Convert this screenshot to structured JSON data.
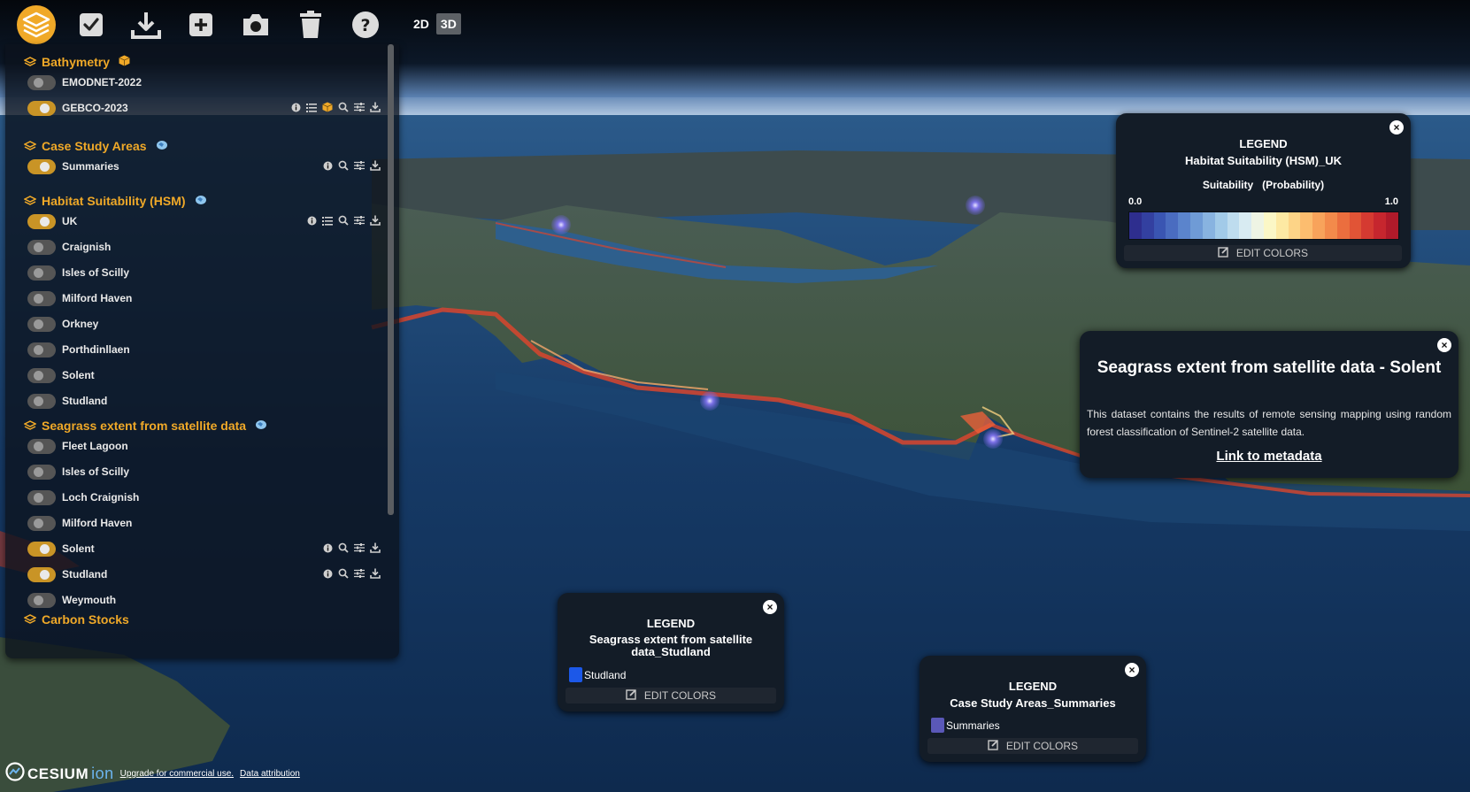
{
  "toolbar": {
    "buttons": [
      {
        "name": "layers",
        "icon": "layers-icon"
      },
      {
        "name": "select",
        "icon": "checkbox-icon"
      },
      {
        "name": "download",
        "icon": "download-icon"
      },
      {
        "name": "add",
        "icon": "plus-icon"
      },
      {
        "name": "screenshot",
        "icon": "camera-icon"
      },
      {
        "name": "delete",
        "icon": "trash-icon"
      },
      {
        "name": "help",
        "icon": "help-icon"
      }
    ],
    "view_modes": [
      "2D",
      "3D"
    ],
    "active_mode": "3D"
  },
  "layer_panel": {
    "groups": [
      {
        "title": "Bathymetry",
        "layers": [
          {
            "name": "EMODNET-2022",
            "on": false,
            "actions": []
          },
          {
            "name": "GEBCO-2023",
            "on": true,
            "actions": [
              "info-icon",
              "list-icon",
              "cube-icon",
              "zoom-icon",
              "sliders-icon",
              "download-icon"
            ]
          }
        ]
      },
      {
        "title": "Case Study Areas",
        "layers": [
          {
            "name": "Summaries",
            "on": true,
            "actions": [
              "info-icon",
              "zoom-icon",
              "sliders-icon",
              "download-icon"
            ]
          }
        ]
      },
      {
        "title": "Habitat Suitability (HSM)",
        "layers": [
          {
            "name": "UK",
            "on": true,
            "actions": [
              "info-icon",
              "list-icon",
              "zoom-icon",
              "sliders-icon",
              "download-icon"
            ]
          },
          {
            "name": "Craignish",
            "on": false,
            "actions": []
          },
          {
            "name": "Isles of Scilly",
            "on": false,
            "actions": []
          },
          {
            "name": "Milford Haven",
            "on": false,
            "actions": []
          },
          {
            "name": "Orkney",
            "on": false,
            "actions": []
          },
          {
            "name": "Porthdinllaen",
            "on": false,
            "actions": []
          },
          {
            "name": "Solent",
            "on": false,
            "actions": []
          },
          {
            "name": "Studland",
            "on": false,
            "actions": []
          }
        ]
      },
      {
        "title": "Seagrass extent from satellite data",
        "layers": [
          {
            "name": "Fleet Lagoon",
            "on": false,
            "actions": []
          },
          {
            "name": "Isles of Scilly",
            "on": false,
            "actions": []
          },
          {
            "name": "Loch Craignish",
            "on": false,
            "actions": []
          },
          {
            "name": "Milford Haven",
            "on": false,
            "actions": []
          },
          {
            "name": "Solent",
            "on": true,
            "actions": [
              "info-icon",
              "zoom-icon",
              "sliders-icon",
              "download-icon"
            ]
          },
          {
            "name": "Studland",
            "on": true,
            "actions": [
              "info-icon",
              "zoom-icon",
              "sliders-icon",
              "download-icon"
            ]
          },
          {
            "name": "Weymouth",
            "on": false,
            "actions": []
          }
        ]
      },
      {
        "title": "Carbon Stocks",
        "layers": []
      }
    ]
  },
  "legend_hsm": {
    "heading": "LEGEND",
    "title": "Habitat Suitability (HSM)_UK",
    "subtitle": "Suitability   (Probability)",
    "min_label": "0.0",
    "max_label": "1.0",
    "edit_label": "EDIT COLORS",
    "ramp": [
      "#2e2e8e",
      "#3340a0",
      "#3a55b2",
      "#4a6cc0",
      "#5b84cc",
      "#6f9bd6",
      "#88b3e0",
      "#a2cae8",
      "#bedcee",
      "#d8ebf2",
      "#eef4e4",
      "#fbf7c6",
      "#fde9a3",
      "#fdd487",
      "#fcbd6f",
      "#f8a35b",
      "#f38a4b",
      "#eb6e3e",
      "#e15436",
      "#d53a31",
      "#c6262e",
      "#b01a2a"
    ]
  },
  "legend_studland": {
    "heading": "LEGEND",
    "title": "Seagrass extent from satellite data_Studland",
    "item_label": "Studland",
    "item_color": "#1c58e8",
    "edit_label": "EDIT COLORS"
  },
  "legend_case": {
    "heading": "LEGEND",
    "title": "Case Study Areas_Summaries",
    "item_label": "Summaries",
    "item_color": "#5a58b8",
    "edit_label": "EDIT COLORS"
  },
  "info_popup": {
    "title": "Seagrass extent from satellite data - Solent",
    "description": "This dataset contains the results of remote sensing mapping using random forest classification of Sentinel-2 satellite data.",
    "link": "Link to metadata"
  },
  "footer": {
    "brand": "CESIUM",
    "brand_suffix": "ion",
    "upgrade_link": "Upgrade for commercial use.",
    "attribution_link": "Data attribution"
  },
  "colors": {
    "accent": "#f0a928",
    "toggle_on": "#c99426",
    "panel_bg": "#0c121c",
    "window_bg": "#131c27"
  }
}
